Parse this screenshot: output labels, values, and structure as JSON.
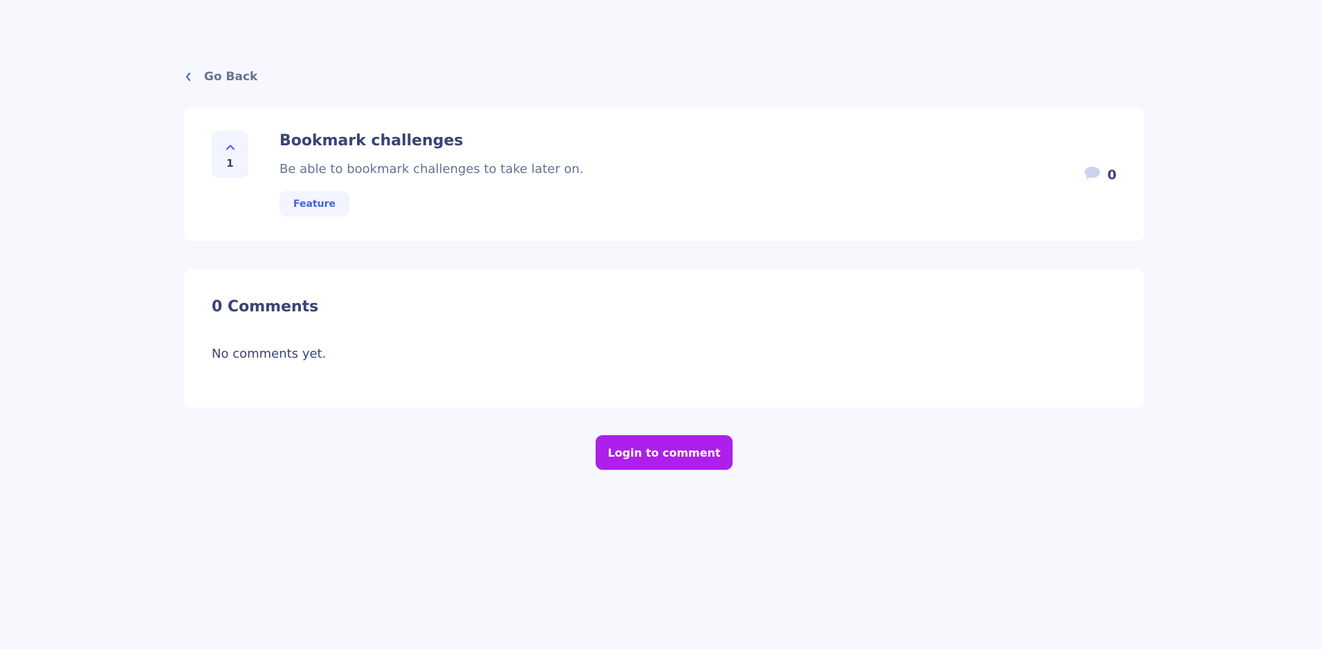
{
  "navigation": {
    "back_label": "Go Back",
    "back_icon": "chevron-left-icon"
  },
  "feedback": {
    "upvotes": "1",
    "upvote_icon": "chevron-up-icon",
    "title": "Bookmark challenges",
    "description": "Be able to bookmark challenges to take later on.",
    "category": "Feature",
    "comment_count": "0",
    "comment_icon": "comment-bubble-icon"
  },
  "comments": {
    "heading": "0 Comments",
    "empty_message": "No comments yet."
  },
  "actions": {
    "login_label": "Login to comment"
  },
  "colors": {
    "background": "#f7f8fd",
    "card": "#ffffff",
    "primary_text": "#3a4374",
    "secondary_text": "#647196",
    "accent_blue": "#4661e6",
    "tag_bg": "#f2f4ff",
    "button_purple": "#ad1fea",
    "comment_icon": "#cdd2ee"
  }
}
